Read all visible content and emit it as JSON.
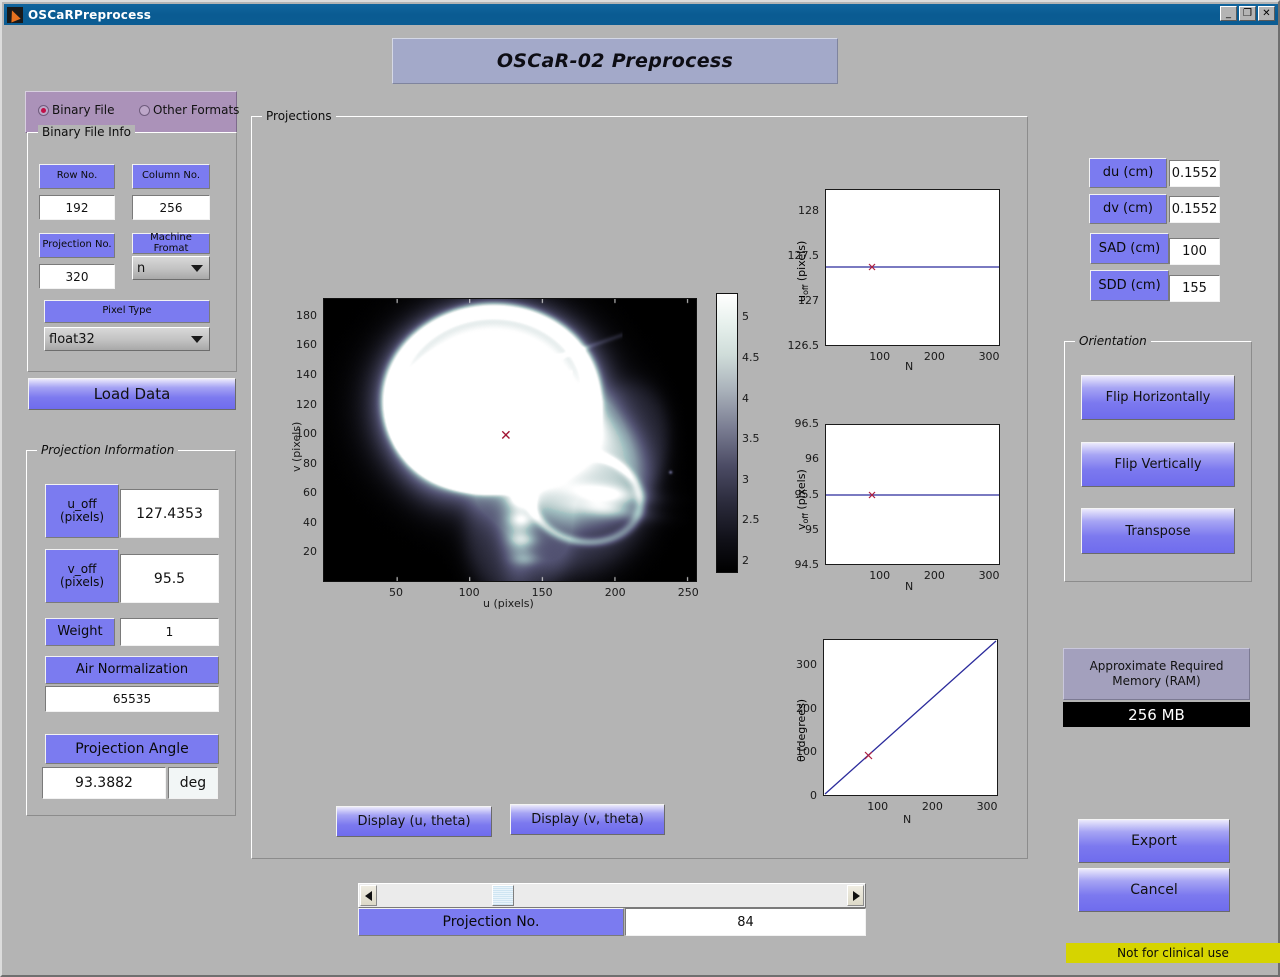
{
  "window": {
    "title": "OSCaRPreprocess",
    "minimize": "_",
    "restore": "❐",
    "close": "✕"
  },
  "banner": {
    "title": "OSCaR-02 Preprocess"
  },
  "format_select": {
    "binary": "Binary File",
    "other": "Other Formats",
    "selected": "Binary File"
  },
  "binary_file_info": {
    "panel_title": "Binary File Info",
    "row_no_label": "Row No.",
    "row_no_value": "192",
    "column_no_label": "Column No.",
    "column_no_value": "256",
    "projection_no_label": "Projection No.",
    "projection_no_value": "320",
    "machine_format_label": "Machine Fromat",
    "machine_format_value": "n",
    "pixel_type_label": "Pixel Type",
    "pixel_type_value": "float32",
    "load_data_button": "Load Data"
  },
  "projection_information": {
    "panel_title": "Projection Information",
    "u_off_label": "u_off\n(pixels)",
    "u_off_line1": "u_off",
    "u_off_line2": "(pixels)",
    "u_off_value": "127.4353",
    "v_off_line1": "v_off",
    "v_off_line2": "(pixels)",
    "v_off_value": "95.5",
    "weight_label": "Weight",
    "weight_value": "1",
    "air_normalization_label": "Air Normalization",
    "air_normalization_value": "65535",
    "projection_angle_label": "Projection Angle",
    "projection_angle_value": "93.3882",
    "projection_angle_unit": "deg"
  },
  "projections_panel": {
    "panel_title": "Projections",
    "display_u_theta_button": "Display (u, theta)",
    "display_v_theta_button": "Display (v, theta)"
  },
  "slider": {
    "projection_no_label": "Projection No.",
    "projection_no_value": "84",
    "left_arrow": "◀",
    "right_arrow": "▶"
  },
  "geometry": {
    "du_label": "du (cm)",
    "du_value": "0.1552",
    "dv_label": "dv (cm)",
    "dv_value": "0.1552",
    "sad_label": "SAD (cm)",
    "sad_value": "100",
    "sdd_label": "SDD (cm)",
    "sdd_value": "155"
  },
  "orientation": {
    "panel_title": "Orientation",
    "flip_horizontally": "Flip Horizontally",
    "flip_vertically": "Flip Vertically",
    "transpose": "Transpose"
  },
  "memory": {
    "label_line1": "Approximate Required",
    "label_line2": "Memory  (RAM)",
    "value": "256 MB"
  },
  "actions": {
    "export": "Export",
    "cancel": "Cancel"
  },
  "status_bar": {
    "text": "Not for clinical use"
  },
  "chart_data": [
    {
      "id": "projection-image",
      "type": "heatmap",
      "title": "",
      "xlabel": "u (pixels)",
      "ylabel": "v (pixels)",
      "xlim": [
        0,
        256
      ],
      "ylim": [
        0,
        192
      ],
      "xticks": [
        50,
        100,
        150,
        200,
        250
      ],
      "yticks": [
        20,
        40,
        60,
        80,
        100,
        120,
        140,
        160,
        180
      ],
      "colorbar": {
        "ticks": [
          2,
          2.5,
          3,
          3.5,
          4,
          4.5,
          5
        ],
        "clim": [
          1.85,
          5.3
        ],
        "colormap": "bone"
      },
      "marker": {
        "label": "x",
        "u": 127.4353,
        "v": 95.5,
        "color": "#a11432"
      },
      "description": "Lateral skull radiograph projection"
    },
    {
      "id": "u-off-vs-n",
      "type": "line",
      "xlabel": "N",
      "ylabel": "u_off (pixels)",
      "xlim": [
        0,
        320
      ],
      "ylim": [
        126.5,
        128.25
      ],
      "xticks": [
        100,
        200,
        300
      ],
      "yticks": [
        126.5,
        127,
        127.5,
        128
      ],
      "series": [
        {
          "name": "u_off",
          "color": "#2b2b9c",
          "constant": 127.4353
        }
      ],
      "marker": {
        "x": 84,
        "y": 127.4353,
        "label": "x",
        "color": "#b02040"
      }
    },
    {
      "id": "v-off-vs-n",
      "type": "line",
      "xlabel": "N",
      "ylabel": "v_off (pixels)",
      "xlim": [
        0,
        320
      ],
      "ylim": [
        94.5,
        96.5
      ],
      "xticks": [
        100,
        200,
        300
      ],
      "yticks": [
        94.5,
        95,
        95.5,
        96,
        96.5
      ],
      "series": [
        {
          "name": "v_off",
          "color": "#2b2b9c",
          "constant": 95.5
        }
      ],
      "marker": {
        "x": 84,
        "y": 95.5,
        "label": "x",
        "color": "#b02040"
      }
    },
    {
      "id": "theta-vs-n",
      "type": "line",
      "xlabel": "N",
      "ylabel": "θ (degrees)",
      "xlim": [
        0,
        320
      ],
      "ylim": [
        0,
        360
      ],
      "xticks": [
        100,
        200,
        300
      ],
      "yticks": [
        0,
        100,
        200,
        300
      ],
      "series": [
        {
          "name": "theta",
          "color": "#2b2b9c",
          "x": [
            0,
            320
          ],
          "y": [
            0,
            359
          ]
        }
      ],
      "marker": {
        "x": 84,
        "y": 93.3882,
        "label": "x",
        "color": "#b02040"
      }
    }
  ],
  "plot_labels": {
    "u_off_axis": "u",
    "u_off_axis_sub": "off",
    "u_off_axis_unit": " (pixels)",
    "v_off_axis": "v",
    "v_off_axis_sub": "off",
    "v_off_axis_unit": " (pixels)",
    "theta_axis": "θ (degrees)",
    "n_axis": "N",
    "u_pixels": "u (pixels)",
    "v_pixels": "v (pixels)"
  }
}
